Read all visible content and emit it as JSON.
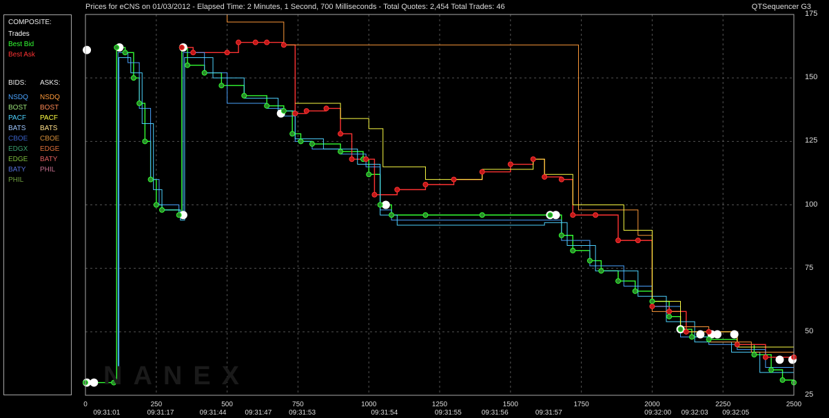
{
  "header": {
    "title": "Prices for  eCNS  on  01/03/2012  -  Elapsed Time: 2 Minutes, 1 Second, 700 Milliseconds  -  Total Quotes: 2,454  Total Trades: 46",
    "brand": "QTSequencer G3"
  },
  "watermark": "NANEX",
  "legend": {
    "composite_header": "COMPOSITE:",
    "composite": [
      {
        "label": "Trades",
        "color": "#ffffff"
      },
      {
        "label": "Best Bid",
        "color": "#33ff33"
      },
      {
        "label": "Best Ask",
        "color": "#ff3333"
      }
    ],
    "bids_header": "BIDS:",
    "asks_header": "ASKS:",
    "bids": [
      {
        "label": "NSDQ",
        "color": "#4aa3ff"
      },
      {
        "label": "BOST",
        "color": "#9be37a"
      },
      {
        "label": "PACF",
        "color": "#4dd2ff"
      },
      {
        "label": "BATS",
        "color": "#9fc7ff"
      },
      {
        "label": "CBOE",
        "color": "#3a62c8"
      },
      {
        "label": "EDGX",
        "color": "#3aa070"
      },
      {
        "label": "EDGE",
        "color": "#7fbf3f"
      },
      {
        "label": "BATY",
        "color": "#5570d8"
      },
      {
        "label": "PHIL",
        "color": "#6f9f3f"
      }
    ],
    "asks": [
      {
        "label": "NSDQ",
        "color": "#ff9a3a"
      },
      {
        "label": "BOST",
        "color": "#ff8a55"
      },
      {
        "label": "PACF",
        "color": "#ffff44"
      },
      {
        "label": "BATS",
        "color": "#ffe08a"
      },
      {
        "label": "CBOE",
        "color": "#d8903a"
      },
      {
        "label": "EDGE",
        "color": "#e0703a"
      },
      {
        "label": "BATY",
        "color": "#e06060"
      },
      {
        "label": "PHIL",
        "color": "#c77090"
      }
    ]
  },
  "chart_data": {
    "type": "line",
    "ylim": [
      25,
      175
    ],
    "xlim": [
      0,
      2500
    ],
    "y_ticks": [
      25,
      50,
      75,
      100,
      125,
      150,
      175
    ],
    "x_ticks": [
      0,
      250,
      500,
      750,
      1000,
      1250,
      1500,
      1750,
      2000,
      2250,
      2500
    ],
    "time_labels": [
      {
        "x": 75,
        "label": "09:31:01"
      },
      {
        "x": 265,
        "label": "09:31:17"
      },
      {
        "x": 450,
        "label": "09:31:44"
      },
      {
        "x": 610,
        "label": "09:31:47"
      },
      {
        "x": 765,
        "label": "09:31:53"
      },
      {
        "x": 1055,
        "label": "09:31:54"
      },
      {
        "x": 1280,
        "label": "09:31:55"
      },
      {
        "x": 1445,
        "label": "09:31:56"
      },
      {
        "x": 1635,
        "label": "09:31:57"
      },
      {
        "x": 2020,
        "label": "09:32:00"
      },
      {
        "x": 2150,
        "label": "09:32:03"
      },
      {
        "x": 2295,
        "label": "09:32:05"
      }
    ],
    "grid": true,
    "series": [
      {
        "name": "Trades",
        "type": "scatter",
        "color": "#ffffff",
        "points": [
          [
            5,
            161
          ],
          [
            5,
            30
          ],
          [
            30,
            30
          ],
          [
            120,
            162
          ],
          [
            345,
            96
          ],
          [
            345,
            162
          ],
          [
            690,
            136
          ],
          [
            1060,
            100
          ],
          [
            1640,
            96
          ],
          [
            1660,
            96
          ],
          [
            2100,
            51
          ],
          [
            2170,
            49
          ],
          [
            2210,
            49
          ],
          [
            2230,
            49
          ],
          [
            2290,
            49
          ],
          [
            2450,
            39
          ],
          [
            2495,
            39
          ]
        ]
      },
      {
        "name": "Best Bid",
        "color": "#33ff33",
        "points": [
          [
            0,
            30
          ],
          [
            100,
            30
          ],
          [
            110,
            162
          ],
          [
            140,
            160
          ],
          [
            170,
            150
          ],
          [
            190,
            140
          ],
          [
            210,
            125
          ],
          [
            230,
            110
          ],
          [
            250,
            100
          ],
          [
            270,
            98
          ],
          [
            330,
            96
          ],
          [
            340,
            162
          ],
          [
            360,
            155
          ],
          [
            420,
            152
          ],
          [
            480,
            147
          ],
          [
            560,
            143
          ],
          [
            640,
            139
          ],
          [
            700,
            137
          ],
          [
            730,
            128
          ],
          [
            760,
            125
          ],
          [
            800,
            124
          ],
          [
            900,
            121
          ],
          [
            980,
            118
          ],
          [
            1000,
            112
          ],
          [
            1040,
            100
          ],
          [
            1080,
            96
          ],
          [
            1200,
            96
          ],
          [
            1400,
            96
          ],
          [
            1640,
            96
          ],
          [
            1680,
            88
          ],
          [
            1720,
            82
          ],
          [
            1780,
            78
          ],
          [
            1820,
            74
          ],
          [
            1880,
            70
          ],
          [
            1940,
            66
          ],
          [
            2000,
            62
          ],
          [
            2060,
            56
          ],
          [
            2100,
            51
          ],
          [
            2140,
            48
          ],
          [
            2200,
            47
          ],
          [
            2300,
            45
          ],
          [
            2360,
            41
          ],
          [
            2420,
            35
          ],
          [
            2460,
            31
          ],
          [
            2500,
            30
          ]
        ]
      },
      {
        "name": "Best Ask",
        "color": "#ff3333",
        "points": [
          [
            340,
            162
          ],
          [
            380,
            160
          ],
          [
            500,
            160
          ],
          [
            540,
            164
          ],
          [
            600,
            164
          ],
          [
            640,
            164
          ],
          [
            700,
            163
          ],
          [
            740,
            136
          ],
          [
            780,
            137
          ],
          [
            850,
            138
          ],
          [
            900,
            128
          ],
          [
            940,
            118
          ],
          [
            990,
            118
          ],
          [
            1020,
            104
          ],
          [
            1100,
            106
          ],
          [
            1200,
            108
          ],
          [
            1300,
            110
          ],
          [
            1400,
            113
          ],
          [
            1500,
            116
          ],
          [
            1580,
            118
          ],
          [
            1620,
            111
          ],
          [
            1680,
            110
          ],
          [
            1720,
            96
          ],
          [
            1800,
            96
          ],
          [
            1880,
            86
          ],
          [
            1950,
            86
          ],
          [
            2000,
            60
          ],
          [
            2060,
            58
          ],
          [
            2120,
            50
          ],
          [
            2200,
            50
          ],
          [
            2300,
            45
          ],
          [
            2400,
            40
          ],
          [
            2500,
            40
          ]
        ]
      },
      {
        "name": "NSDQ",
        "color": "#4aa3ff",
        "points": [
          [
            100,
            30
          ],
          [
            115,
            160
          ],
          [
            150,
            156
          ],
          [
            190,
            138
          ],
          [
            230,
            110
          ],
          [
            260,
            100
          ],
          [
            330,
            96
          ],
          [
            345,
            160
          ],
          [
            420,
            152
          ],
          [
            500,
            140
          ],
          [
            640,
            138
          ],
          [
            700,
            135
          ],
          [
            740,
            125
          ],
          [
            800,
            122
          ],
          [
            900,
            120
          ],
          [
            990,
            115
          ],
          [
            1040,
            98
          ],
          [
            1080,
            94
          ],
          [
            1600,
            94
          ],
          [
            1680,
            86
          ],
          [
            1780,
            76
          ],
          [
            1900,
            68
          ],
          [
            2000,
            60
          ],
          [
            2100,
            48
          ],
          [
            2200,
            45
          ],
          [
            2300,
            43
          ],
          [
            2400,
            36
          ],
          [
            2500,
            30
          ]
        ]
      },
      {
        "name": "PACF",
        "color": "#4dd2ff",
        "points": [
          [
            100,
            30
          ],
          [
            118,
            158
          ],
          [
            160,
            152
          ],
          [
            200,
            132
          ],
          [
            240,
            106
          ],
          [
            270,
            98
          ],
          [
            335,
            94
          ],
          [
            350,
            158
          ],
          [
            450,
            150
          ],
          [
            560,
            142
          ],
          [
            680,
            137
          ],
          [
            740,
            126
          ],
          [
            840,
            122
          ],
          [
            960,
            116
          ],
          [
            1040,
            96
          ],
          [
            1100,
            92
          ],
          [
            1620,
            93
          ],
          [
            1700,
            84
          ],
          [
            1800,
            74
          ],
          [
            1950,
            64
          ],
          [
            2050,
            54
          ],
          [
            2150,
            46
          ],
          [
            2280,
            42
          ],
          [
            2380,
            34
          ],
          [
            2500,
            30
          ]
        ]
      },
      {
        "name": "NSDQ Ask",
        "color": "#ff9a3a",
        "points": [
          [
            340,
            175
          ],
          [
            500,
            172
          ],
          [
            700,
            163
          ],
          [
            1350,
            163
          ],
          [
            1600,
            163
          ],
          [
            1700,
            163
          ],
          [
            1740,
            98
          ],
          [
            1850,
            98
          ],
          [
            1950,
            88
          ],
          [
            2000,
            58
          ],
          [
            2100,
            52
          ],
          [
            2200,
            46
          ],
          [
            2350,
            42
          ],
          [
            2500,
            42
          ]
        ]
      },
      {
        "name": "PACF Ask",
        "color": "#ffff44",
        "points": [
          [
            740,
            140
          ],
          [
            900,
            134
          ],
          [
            1000,
            130
          ],
          [
            1050,
            115
          ],
          [
            1200,
            110
          ],
          [
            1400,
            114
          ],
          [
            1580,
            118
          ],
          [
            1620,
            112
          ],
          [
            1720,
            100
          ],
          [
            1900,
            90
          ],
          [
            2000,
            62
          ],
          [
            2100,
            50
          ],
          [
            2300,
            44
          ],
          [
            2500,
            40
          ]
        ]
      }
    ]
  }
}
